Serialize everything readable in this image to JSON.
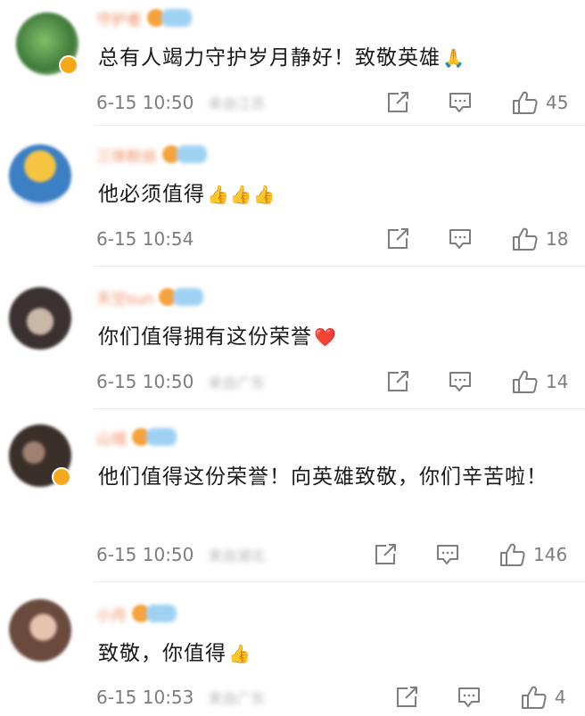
{
  "colors": {
    "name": "#f08a5d",
    "meta": "#7d7d7d",
    "badge": "#f6a81b",
    "vip": "#9fd1f3"
  },
  "comments": [
    {
      "name": "守护者",
      "text": "总有人竭力守护岁月静好！致敬英雄",
      "emoji": "🙏",
      "time": "6-15 10:50",
      "location": "来自江苏",
      "likes": "45"
    },
    {
      "name": "三体粉丝",
      "text": "他必须值得",
      "emoji": "👍👍👍",
      "time": "6-15 10:54",
      "location": "",
      "likes": "18"
    },
    {
      "name": "天空sun",
      "text": "你们值得拥有这份荣誉",
      "emoji": "❤️",
      "time": "6-15 10:50",
      "location": "来自广东",
      "likes": "14"
    },
    {
      "name": "山城",
      "text": "他们值得这份荣誉！向英雄致敬，你们辛苦啦！",
      "emoji": "",
      "time": "6-15 10:50",
      "location": "来自湖北",
      "likes": "146"
    },
    {
      "name": "小月",
      "text": "致敬，你值得",
      "emoji": "👍",
      "time": "6-15 10:53",
      "location": "来自广东",
      "likes": "4"
    }
  ]
}
